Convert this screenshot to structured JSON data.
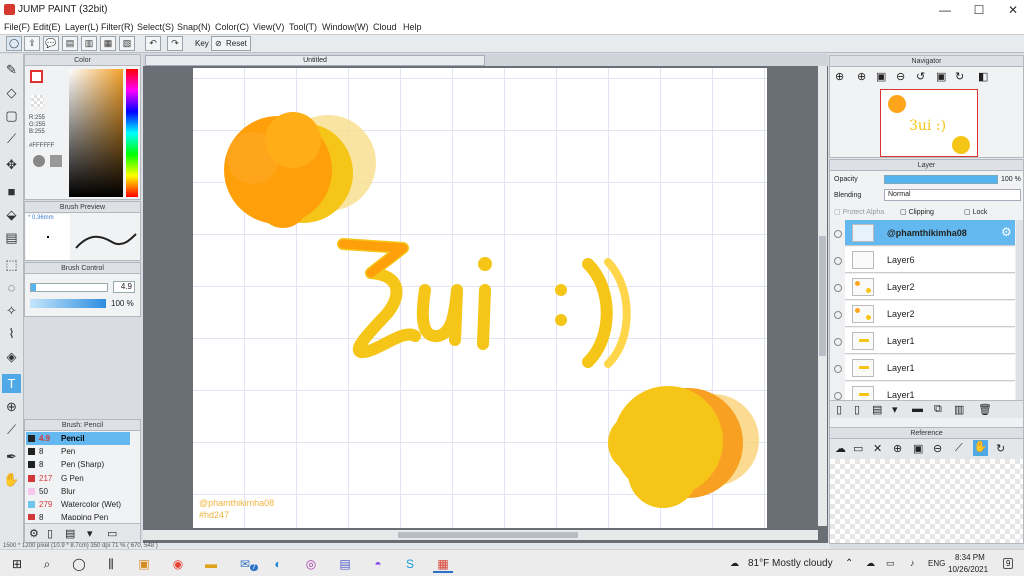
{
  "window": {
    "title": "JUMP PAINT (32bit)",
    "min": "—",
    "max": "☐",
    "close": "✕"
  },
  "menu": [
    "File(F)",
    "Edit(E)",
    "Layer(L)",
    "Filter(R)",
    "Select(S)",
    "Snap(N)",
    "Color(C)",
    "View(V)",
    "Tool(T)",
    "Window(W)",
    "Cloud",
    "Help"
  ],
  "toolbar": {
    "key_label": "Key",
    "reset_label": "Reset"
  },
  "color_panel": {
    "title": "Color",
    "r": "R:255",
    "g": "G:255",
    "b": "B:255",
    "hex": "#FFFFFF"
  },
  "brush_preview": {
    "title": "Brush Preview",
    "size": "* 0.36mm"
  },
  "brush_control": {
    "title": "Brush Control",
    "size_value": "4.9",
    "opacity_value": "100 %"
  },
  "brush_list": {
    "title": "Brush: Pencil",
    "items": [
      {
        "size": "4.9",
        "name": "Pencil",
        "color": "#222222"
      },
      {
        "size": "8",
        "name": "Pen",
        "color": "#222222"
      },
      {
        "size": "8",
        "name": "Pen (Sharp)",
        "color": "#222222"
      },
      {
        "size": "217",
        "name": "G Pen",
        "color": "#d23a3a"
      },
      {
        "size": "50",
        "name": "Blur",
        "color": "#f5c6ee"
      },
      {
        "size": "279",
        "name": "Watercolor (Wet)",
        "color": "#6ec6ef"
      },
      {
        "size": "8",
        "name": "Mapping Pen",
        "color": "#d23a3a"
      }
    ]
  },
  "canvas": {
    "tab_title": "Untitled",
    "lettering": "Zui :))",
    "watermark": "@phamthikimha08",
    "hashtag": "#hd247"
  },
  "status_bar": "1500 * 1200 pixel   (10.9 * 8.7cm)   350 dpi   71 %   ( 670, 548 )",
  "navigator": {
    "title": "Navigator"
  },
  "layer_panel": {
    "title": "Layer",
    "opacity_label": "Opacity",
    "opacity_value": "100 %",
    "blending_label": "Blending",
    "blending_value": "Normal",
    "protect_alpha": "Protect Alpha",
    "clipping": "Clipping",
    "lock": "Lock",
    "layers": [
      "@phamthikimha08",
      "Layer6",
      "Layer2",
      "Layer2",
      "Layer1",
      "Layer1",
      "Layer1"
    ]
  },
  "reference": {
    "title": "Reference"
  },
  "taskbar": {
    "weather": "81°F  Mostly cloudy",
    "lang": "ENG",
    "time": "8:34 PM",
    "date": "10/26/2021",
    "mail_badge": "7",
    "notif_badge": "9"
  },
  "colors": {
    "accent": "#4fa9e6",
    "yellow": "#f4c20d",
    "orange": "#ff9f0a"
  }
}
